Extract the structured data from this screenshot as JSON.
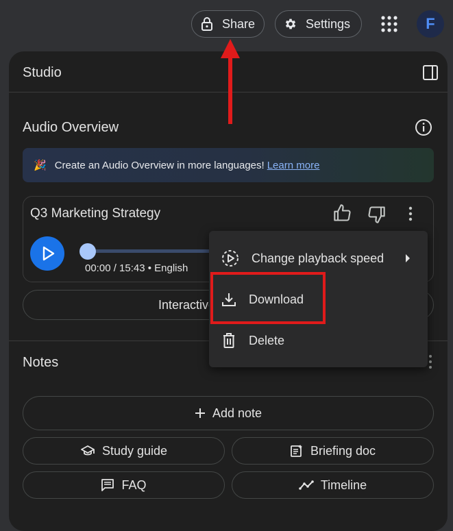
{
  "header": {
    "share_label": "Share",
    "settings_label": "Settings",
    "avatar_letter": "F"
  },
  "studio": {
    "title": "Studio",
    "audio_overview": {
      "heading": "Audio Overview",
      "banner_text": "Create an Audio Overview in more languages!",
      "banner_link": "Learn more",
      "card": {
        "title": "Q3 Marketing Strategy",
        "time": "00:00 / 15:43 • English",
        "progress": 0
      },
      "interactive_label": "Interactive mode"
    },
    "menu": {
      "items": [
        {
          "label": "Change playback speed",
          "icon": "playback-speed-icon"
        },
        {
          "label": "Download",
          "icon": "download-icon"
        },
        {
          "label": "Delete",
          "icon": "trash-icon"
        }
      ]
    },
    "notes": {
      "heading": "Notes",
      "add_note_label": "Add note",
      "buttons": [
        {
          "label": "Study guide",
          "icon": "graduation-cap-icon"
        },
        {
          "label": "Briefing doc",
          "icon": "document-icon"
        },
        {
          "label": "FAQ",
          "icon": "chat-icon"
        },
        {
          "label": "Timeline",
          "icon": "timeline-icon"
        }
      ]
    }
  },
  "colors": {
    "accent": "#1a73e8",
    "highlight": "#e01b1b",
    "link": "#8ab4f8"
  }
}
